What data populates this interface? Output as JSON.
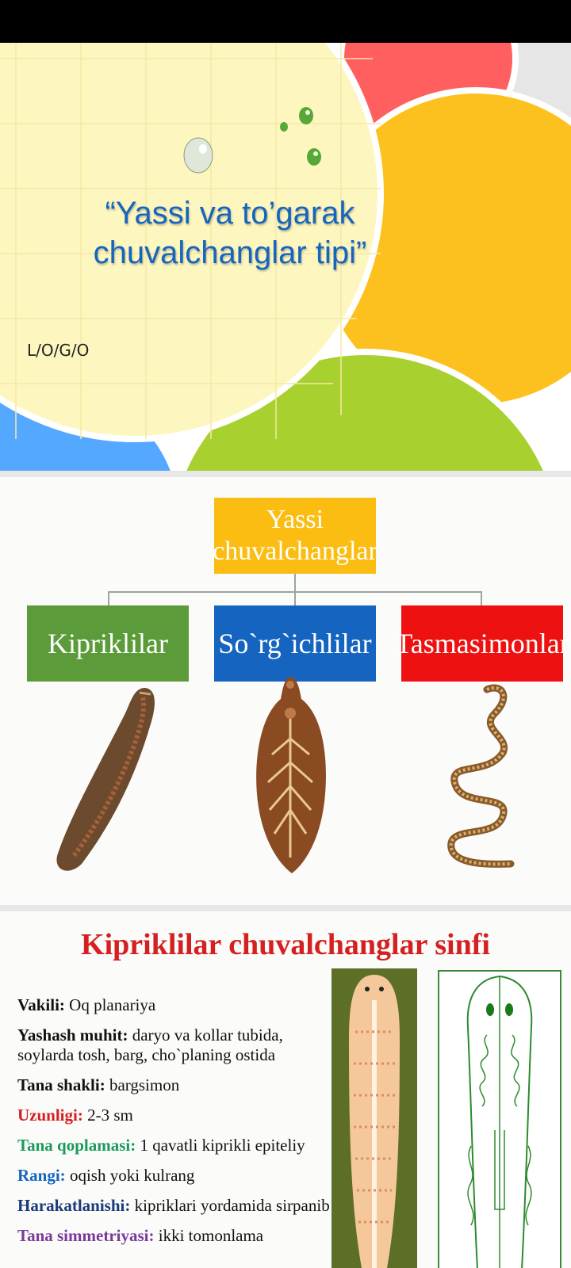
{
  "slide1": {
    "title_line1": "“Yassi va to’garak",
    "title_line2": "chuvalchanglar tipi”",
    "logo": "L/O/G/O",
    "colors": {
      "title": "#1565c0",
      "yellow_bg": "#fdf6bf",
      "red": "#ff5f5f",
      "orange": "#fdc11f",
      "green": "#a8d130",
      "blue": "#55a8ff"
    }
  },
  "slide2": {
    "root_line1": "Yassi",
    "root_line2": "chuvalchanglar",
    "classes": [
      {
        "label": "Kipriklilar",
        "color": "#5b9b3a"
      },
      {
        "label": "So`rg`ichlilar",
        "color": "#1565c0"
      },
      {
        "label": "Tasmasimonlar",
        "color": "#ee1111"
      }
    ],
    "root_color": "#fbbd12"
  },
  "slide3": {
    "title": "Kipriklilar chuvalchanglar sinfi",
    "facts": [
      {
        "key": "Vakili:",
        "value": " Oq planariya",
        "key_color": "#111111"
      },
      {
        "key": "Yashash muhit:",
        "value": " daryo va kollar tubida, soylarda tosh, barg, cho`planing ostida",
        "key_color": "#111111"
      },
      {
        "key": "Tana shakli:",
        "value": " bargsimon",
        "key_color": "#111111"
      },
      {
        "key": "Uzunligi:",
        "value": " 2-3 sm",
        "key_color": "#d42020"
      },
      {
        "key": "Tana qoplamasi:",
        "value": " 1 qavatli kiprikli epiteliy",
        "key_color": "#1a9a5a"
      },
      {
        "key": "Rangi:",
        "value": " oqish yoki kulrang",
        "key_color": "#1565c0"
      },
      {
        "key": "Harakatlanishi:",
        "value": " kipriklari yordamida sirpanib",
        "key_color": "#1a3a7a"
      },
      {
        "key": "Tana simmetriyasi:",
        "value": " ikki tomonlama",
        "key_color": "#7a3a9a"
      }
    ]
  }
}
